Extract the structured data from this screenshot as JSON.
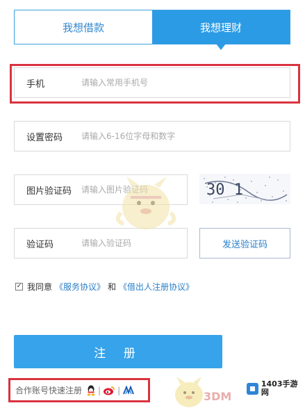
{
  "tabs": [
    {
      "label": "我想借款",
      "active": false
    },
    {
      "label": "我想理财",
      "active": true
    }
  ],
  "fields": {
    "phone": {
      "label": "手机",
      "placeholder": "请输入常用手机号"
    },
    "password": {
      "label": "设置密码",
      "placeholder": "请输入6-16位字母和数字"
    },
    "image_captcha": {
      "label": "图片验证码",
      "placeholder": "请输入图片验证码"
    },
    "sms_code": {
      "label": "验证码",
      "placeholder": "请输入验证码"
    }
  },
  "captcha": {
    "text": "30  1"
  },
  "send_code_label": "发送验证码",
  "agreement": {
    "prefix": "我同意",
    "service_link": "《服务协议》",
    "conjunction": "和",
    "borrower_link": "《借出人注册协议》"
  },
  "register_label": "注 册",
  "quick_register": {
    "label": "合作账号快速注册",
    "icons": [
      "qq-icon",
      "weibo-icon",
      "renren-icon"
    ]
  },
  "watermarks": {
    "brand": "3DM",
    "site_name": "1403手游网"
  },
  "colors": {
    "accent": "#2b9be6",
    "highlight": "#d9333f",
    "link": "#2a7fc9"
  }
}
